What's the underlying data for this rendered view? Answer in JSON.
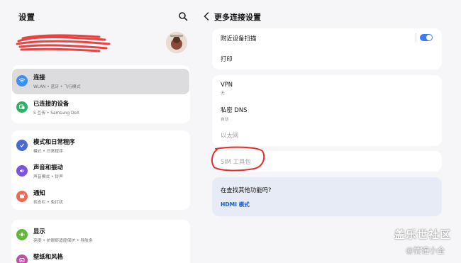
{
  "left": {
    "title": "设置",
    "groups": [
      {
        "items": [
          {
            "title": "连接",
            "sub": "WLAN • 蓝牙 • 飞行模式",
            "icon": "wifi-icon",
            "color": "#3d8ff3",
            "active": true
          },
          {
            "title": "已连接的设备",
            "sub": "S 互传 • Samsung DeX",
            "icon": "devices-icon",
            "color": "#2fb06a"
          }
        ]
      },
      {
        "items": [
          {
            "title": "模式和日常程序",
            "sub": "模式 • 日常程序",
            "icon": "check-circle-icon",
            "color": "#4a68d6"
          },
          {
            "title": "声音和振动",
            "sub": "声音模式 • 铃声",
            "icon": "speaker-icon",
            "color": "#7b55e2"
          },
          {
            "title": "通知",
            "sub": "状态栏 • 免打扰",
            "icon": "bell-icon",
            "color": "#ef6a52"
          }
        ]
      },
      {
        "items": [
          {
            "title": "显示",
            "sub": "亮度 • 护眼舒适度保护 • 导航条",
            "icon": "sun-icon",
            "color": "#5fb83a"
          },
          {
            "title": "壁纸和风格",
            "sub": "",
            "icon": "palette-icon",
            "color": "#c24ea6"
          }
        ]
      }
    ]
  },
  "right": {
    "title": "更多连接设置",
    "card1": [
      {
        "title": "附近设备扫描",
        "toggle": true
      },
      {
        "title": "打印"
      }
    ],
    "card2": [
      {
        "title": "VPN",
        "sub": "无"
      },
      {
        "title": "私密 DNS",
        "sub": "自动"
      },
      {
        "title": "以太网",
        "dim": true
      }
    ],
    "card3": [
      {
        "title": "SIM 工具包",
        "dim": true
      }
    ],
    "hint": {
      "title": "在查找其他功能吗?",
      "link": "HDMI 模式"
    }
  },
  "watermark": {
    "line1": "盖乐世社区",
    "line2": "@情谊小全"
  },
  "colors": {
    "accent": "#3e7bf2",
    "link": "#1f5fbf",
    "annotation_red": "#e4302d"
  }
}
